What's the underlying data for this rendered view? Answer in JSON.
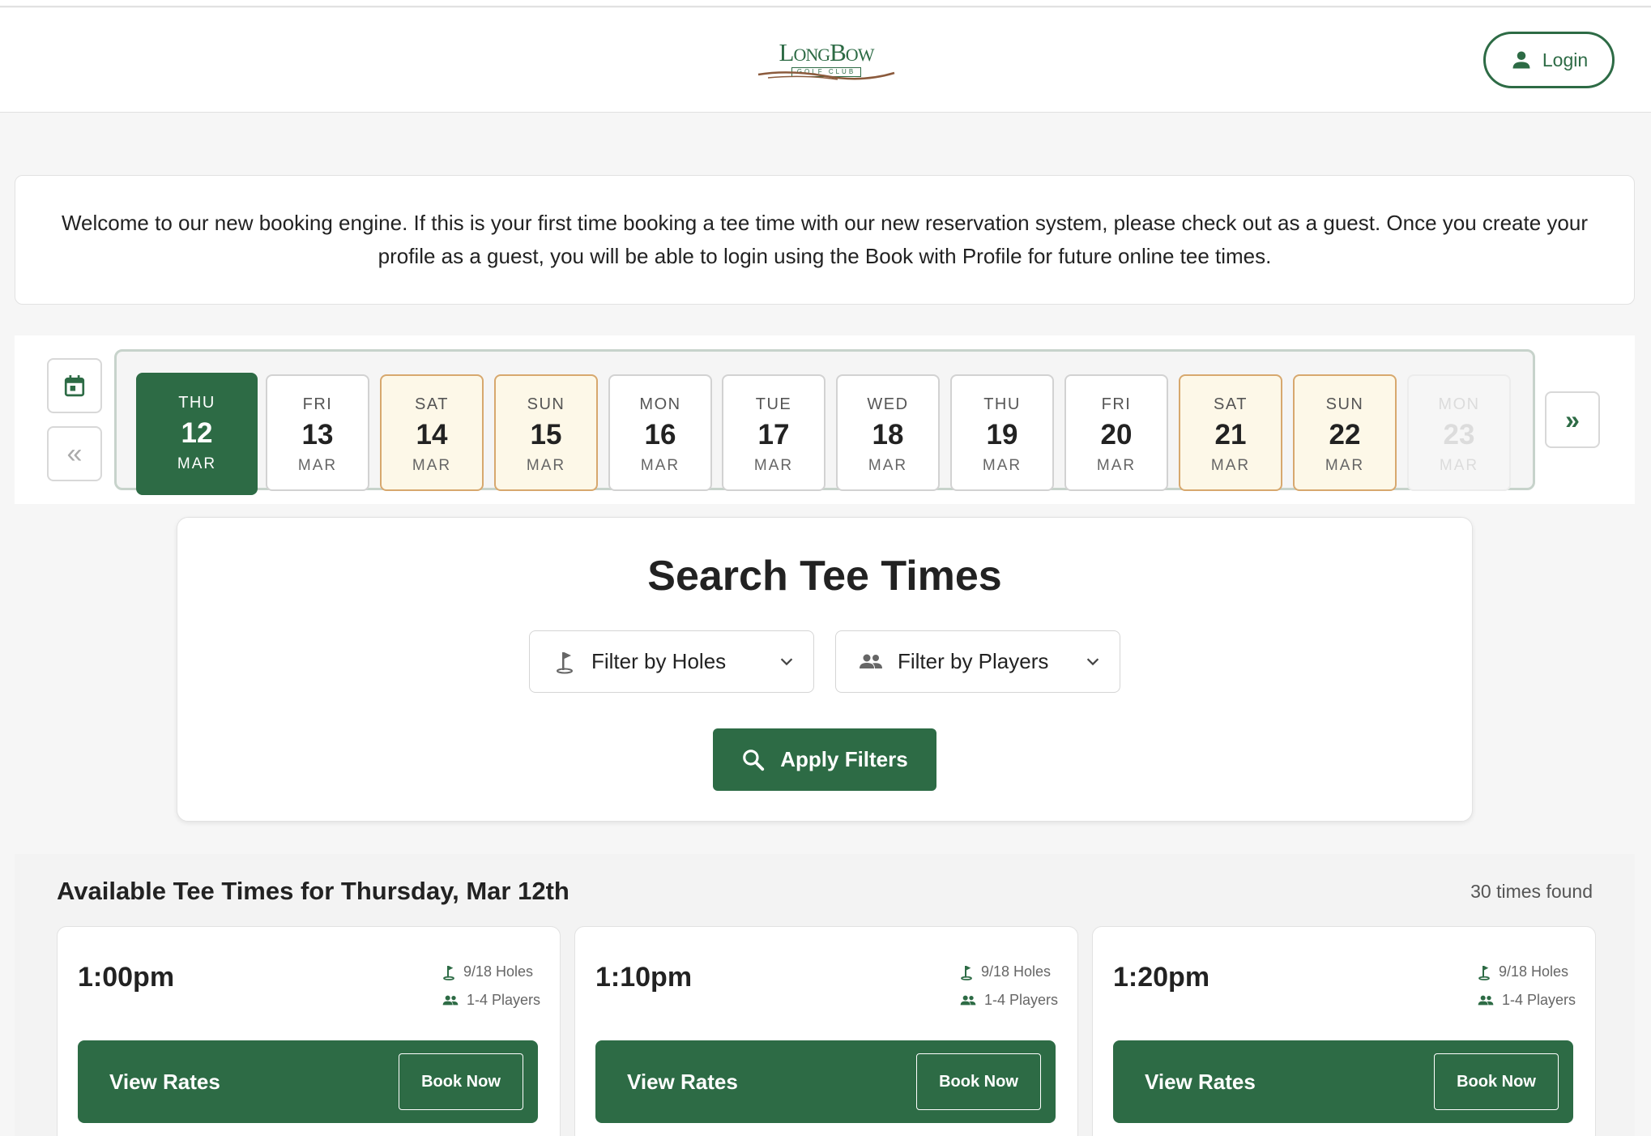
{
  "header": {
    "logo_text": "LongBow",
    "logo_sub": "GOLF CLUB",
    "login_label": "Login"
  },
  "welcome": {
    "text": "Welcome to our new booking engine.  If this is your first time booking a tee time with our new reservation system, please check out as a guest.  Once you create your profile as a guest, you will be able to login using the Book with Profile for future online tee times."
  },
  "datebar": {
    "prev_label": "«",
    "next_label": "»",
    "days": [
      {
        "dow": "THU",
        "num": "12",
        "mon": "MAR",
        "state": "selected"
      },
      {
        "dow": "FRI",
        "num": "13",
        "mon": "MAR",
        "state": "normal"
      },
      {
        "dow": "SAT",
        "num": "14",
        "mon": "MAR",
        "state": "weekend"
      },
      {
        "dow": "SUN",
        "num": "15",
        "mon": "MAR",
        "state": "weekend"
      },
      {
        "dow": "MON",
        "num": "16",
        "mon": "MAR",
        "state": "normal"
      },
      {
        "dow": "TUE",
        "num": "17",
        "mon": "MAR",
        "state": "normal"
      },
      {
        "dow": "WED",
        "num": "18",
        "mon": "MAR",
        "state": "normal"
      },
      {
        "dow": "THU",
        "num": "19",
        "mon": "MAR",
        "state": "normal"
      },
      {
        "dow": "FRI",
        "num": "20",
        "mon": "MAR",
        "state": "normal"
      },
      {
        "dow": "SAT",
        "num": "21",
        "mon": "MAR",
        "state": "weekend"
      },
      {
        "dow": "SUN",
        "num": "22",
        "mon": "MAR",
        "state": "weekend"
      },
      {
        "dow": "MON",
        "num": "23",
        "mon": "MAR",
        "state": "disabled"
      }
    ]
  },
  "search": {
    "title": "Search Tee Times",
    "filter_holes": "Filter by Holes",
    "filter_players": "Filter by Players",
    "apply_label": "Apply Filters"
  },
  "results": {
    "title": "Available Tee Times for Thursday, Mar 12th",
    "count": "30 times found",
    "cards": [
      {
        "time": "1:00pm",
        "holes": "9/18 Holes",
        "players": "1-4 Players",
        "rates": "View Rates",
        "book": "Book Now"
      },
      {
        "time": "1:10pm",
        "holes": "9/18 Holes",
        "players": "1-4 Players",
        "rates": "View Rates",
        "book": "Book Now"
      },
      {
        "time": "1:20pm",
        "holes": "9/18 Holes",
        "players": "1-4 Players",
        "rates": "View Rates",
        "book": "Book Now"
      }
    ]
  },
  "colors": {
    "brand_green": "#2d6b45",
    "weekend_bg": "#fdf8e8",
    "weekend_border": "#d7a86e"
  }
}
